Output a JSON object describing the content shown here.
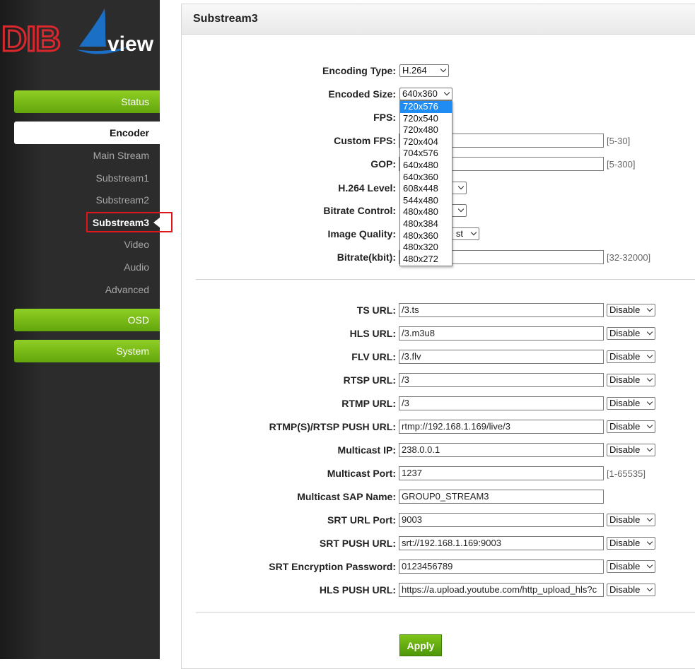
{
  "sidebar": {
    "logo_text_left": "DIB",
    "logo_text_right": "view",
    "status": "Status",
    "encoder": "Encoder",
    "sub_items": [
      "Main Stream",
      "Substream1",
      "Substream2",
      "Substream3",
      "Video",
      "Audio",
      "Advanced"
    ],
    "osd": "OSD",
    "system": "System"
  },
  "panel": {
    "title": "Substream3",
    "encoding": {
      "encoding_type_label": "Encoding Type:",
      "encoding_type_value": "H.264",
      "encoded_size_label": "Encoded Size:",
      "encoded_size_value": "640x360",
      "size_options": [
        "720x576",
        "720x540",
        "720x480",
        "720x404",
        "704x576",
        "640x480",
        "640x360",
        "608x448",
        "544x480",
        "480x480",
        "480x384",
        "480x360",
        "480x320",
        "480x272"
      ],
      "fps_label": "FPS:",
      "custom_fps_label": "Custom FPS:",
      "custom_fps_range": "[5-30]",
      "gop_label": "GOP:",
      "gop_range": "[5-300]",
      "h264_level_label": "H.264 Level:",
      "bitrate_control_label": "Bitrate Control:",
      "image_quality_label": "Image Quality:",
      "image_quality_value_tail": "st",
      "bitrate_label": "Bitrate(kbit):",
      "bitrate_range": "[32-32000]"
    },
    "urls": [
      {
        "label": "TS URL:",
        "value": "/3.ts",
        "mode": "Disable"
      },
      {
        "label": "HLS URL:",
        "value": "/3.m3u8",
        "mode": "Disable"
      },
      {
        "label": "FLV URL:",
        "value": "/3.flv",
        "mode": "Disable"
      },
      {
        "label": "RTSP URL:",
        "value": "/3",
        "mode": "Disable"
      },
      {
        "label": "RTMP URL:",
        "value": "/3",
        "mode": "Disable"
      },
      {
        "label": "RTMP(S)/RTSP PUSH URL:",
        "value": "rtmp://192.168.1.169/live/3",
        "mode": "Disable"
      },
      {
        "label": "Multicast IP:",
        "value": "238.0.0.1",
        "mode": "Disable"
      },
      {
        "label": "Multicast Port:",
        "value": "1237",
        "range": "[1-65535]"
      },
      {
        "label": "Multicast SAP Name:",
        "value": "GROUP0_STREAM3"
      },
      {
        "label": "SRT URL Port:",
        "value": "9003",
        "mode": "Disable"
      },
      {
        "label": "SRT PUSH URL:",
        "value": "srt://192.168.1.169:9003",
        "mode": "Disable"
      },
      {
        "label": "SRT Encryption Password:",
        "value": "0123456789",
        "mode": "Disable"
      },
      {
        "label": "HLS PUSH URL:",
        "value": "https://a.upload.youtube.com/http_upload_hls?c",
        "mode": "Disable"
      }
    ],
    "apply": "Apply"
  },
  "colors": {
    "nav_green": "#6fb312",
    "sidebar_bg": "#2c2c2c",
    "highlight_red": "#e0161d",
    "logo_red": "#d8282e",
    "logo_blue": "#1b6fc4",
    "selected_option": "#1e8cf3"
  }
}
